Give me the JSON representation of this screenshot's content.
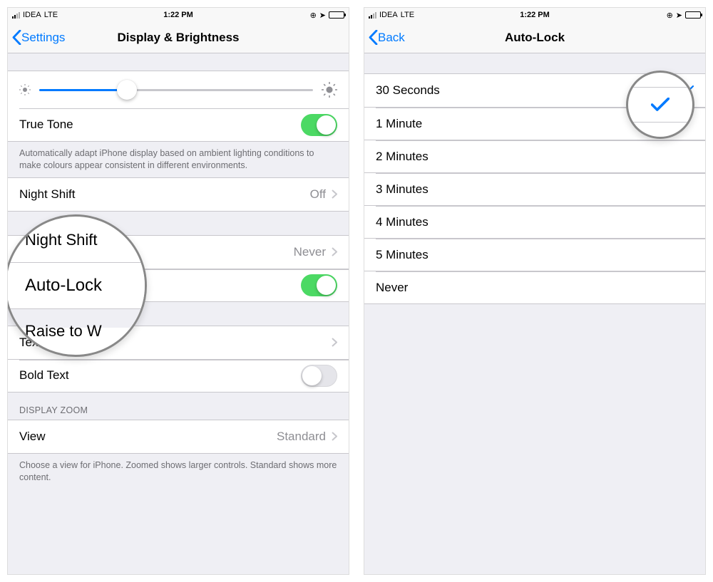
{
  "left": {
    "status": {
      "carrier": "IDEA",
      "network": "LTE",
      "time": "1:22 PM"
    },
    "nav": {
      "back": "Settings",
      "title": "Display & Brightness"
    },
    "true_tone": {
      "label": "True Tone",
      "on": true
    },
    "brightness_footer": "Automatically adapt iPhone display based on ambient lighting conditions to make colours appear consistent in different environments.",
    "night_shift": {
      "label": "Night Shift",
      "value": "Off"
    },
    "auto_lock": {
      "label": "Auto-Lock",
      "value": "Never"
    },
    "raise_to_wake": {
      "label": "Raise to Wake",
      "on": true
    },
    "text_size": {
      "label": "Text Size"
    },
    "bold_text": {
      "label": "Bold Text",
      "on": false
    },
    "display_zoom_header": "DISPLAY ZOOM",
    "view": {
      "label": "View",
      "value": "Standard"
    },
    "zoom_footer": "Choose a view for iPhone. Zoomed shows larger controls. Standard shows more content.",
    "magnifier": {
      "top_peek": "Night Shift",
      "focus": "Auto-Lock",
      "bottom_peek": "Raise to W"
    }
  },
  "right": {
    "status": {
      "carrier": "IDEA",
      "network": "LTE",
      "time": "1:22 PM"
    },
    "nav": {
      "back": "Back",
      "title": "Auto-Lock"
    },
    "options": [
      {
        "label": "30 Seconds",
        "selected": true
      },
      {
        "label": "1 Minute",
        "selected": false
      },
      {
        "label": "2 Minutes",
        "selected": false
      },
      {
        "label": "3 Minutes",
        "selected": false
      },
      {
        "label": "4 Minutes",
        "selected": false
      },
      {
        "label": "5 Minutes",
        "selected": false
      },
      {
        "label": "Never",
        "selected": false
      }
    ]
  }
}
